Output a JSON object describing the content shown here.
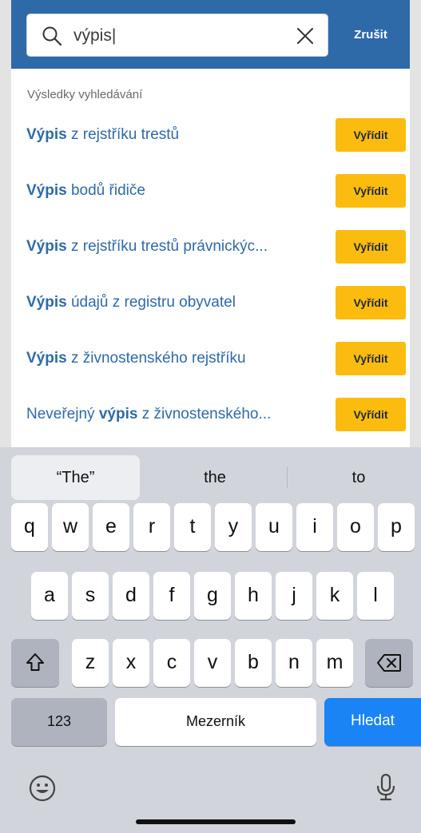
{
  "search": {
    "query": "výpis|",
    "cancel_label": "Zrušit"
  },
  "results": {
    "heading": "Výsledky vyhledávání",
    "action_label": "Vyřídit",
    "items": [
      {
        "pre": "",
        "bold": "Výpis",
        "post": " z rejstříku trestů"
      },
      {
        "pre": "",
        "bold": "Výpis",
        "post": " bodů řidiče"
      },
      {
        "pre": "",
        "bold": "Výpis",
        "post": " z rejstříku trestů právnickýc..."
      },
      {
        "pre": "",
        "bold": "Výpis",
        "post": " údajů z registru obyvatel"
      },
      {
        "pre": "",
        "bold": "Výpis",
        "post": " z živnostenského rejstříku"
      },
      {
        "pre": "Neveřejný ",
        "bold": "výpis",
        "post": " z živnostenského..."
      }
    ]
  },
  "keyboard": {
    "suggestions": [
      "“The”",
      "the",
      "to"
    ],
    "row1": [
      "q",
      "w",
      "e",
      "r",
      "t",
      "y",
      "u",
      "i",
      "o",
      "p"
    ],
    "row2": [
      "a",
      "s",
      "d",
      "f",
      "g",
      "h",
      "j",
      "k",
      "l"
    ],
    "row3": [
      "z",
      "x",
      "c",
      "v",
      "b",
      "n",
      "m"
    ],
    "numbers_label": "123",
    "space_label": "Mezerník",
    "return_label": "Hledat"
  },
  "colors": {
    "header": "#2e6aa8",
    "link": "#2e6aa8",
    "action": "#fbbc0f",
    "return_key": "#1a83f5"
  },
  "icons": {
    "search": "magnifier-icon",
    "clear": "close-icon",
    "shift": "shift-icon",
    "backspace": "backspace-icon",
    "emoji": "emoji-icon",
    "mic": "microphone-icon"
  }
}
